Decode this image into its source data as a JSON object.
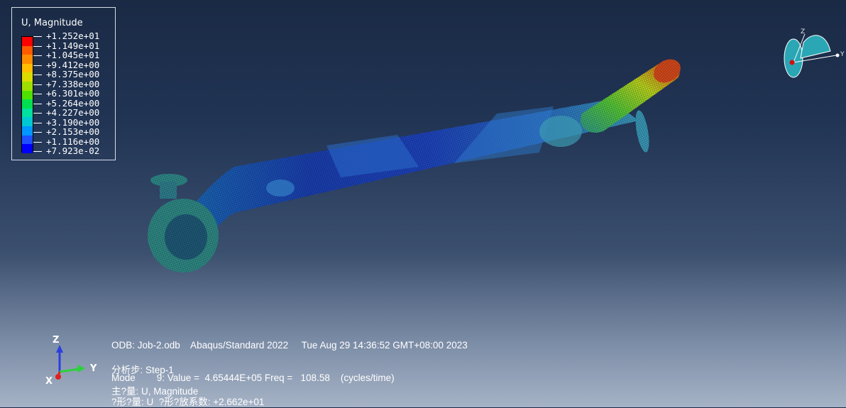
{
  "legend": {
    "title": "U, Magnitude",
    "values": [
      "+1.252e+01",
      "+1.149e+01",
      "+1.045e+01",
      "+9.412e+00",
      "+8.375e+00",
      "+7.338e+00",
      "+6.301e+00",
      "+5.264e+00",
      "+4.227e+00",
      "+3.190e+00",
      "+2.153e+00",
      "+1.116e+00",
      "+7.923e-02"
    ],
    "colors": [
      "#ff0000",
      "#ff5a00",
      "#ff8c00",
      "#ffbe00",
      "#dcdc00",
      "#9ee000",
      "#50e000",
      "#00e050",
      "#00e0a0",
      "#00c8d2",
      "#0096ff",
      "#1e50ff",
      "#0000ff"
    ]
  },
  "info": {
    "line1": "ODB: Job-2.odb    Abaqus/Standard 2022     Tue Aug 29 14:36:52 GMT+08:00 2023",
    "line2": "分析步: Step-1",
    "line3": "Mode        9: Value =  4.65444E+05 Freq =   108.58    (cycles/time)",
    "line4": "主?量: U, Magnitude",
    "line5": "?形?量: U  ?形?放系数: +2.662e+01"
  },
  "triad": {
    "z": "Z",
    "y": "Y",
    "x": "X"
  },
  "view_cube": {
    "z": "Z",
    "y": "Y"
  }
}
